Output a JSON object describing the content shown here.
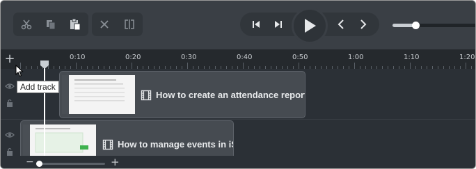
{
  "toolbar": {
    "edit_buttons": [
      {
        "name": "cut",
        "icon": "scissors-icon"
      },
      {
        "name": "copy",
        "icon": "copy-icon"
      },
      {
        "name": "paste",
        "icon": "paste-icon"
      }
    ],
    "cut_buttons": [
      {
        "name": "delete",
        "icon": "x-icon"
      },
      {
        "name": "split",
        "icon": "split-icon"
      }
    ],
    "playback": [
      "step-back-icon",
      "step-forward-icon",
      "play-icon",
      "prev-icon",
      "next-icon"
    ],
    "scrub_position": 0.27
  },
  "ruler": {
    "add_track_label": "+",
    "ticks": [
      "0:10",
      "0:20",
      "0:30",
      "0:40",
      "0:50",
      "1:00",
      "1:10",
      "1:20"
    ]
  },
  "tooltip": {
    "text": "Add track"
  },
  "clips": [
    {
      "title": "How to create an attendance report?"
    },
    {
      "title": "How to manage events in iSp"
    }
  ],
  "zoom": {
    "minus": "−",
    "plus": "+",
    "level": 0.0
  },
  "colors": {
    "toolbar": "#3a3f45",
    "ruler": "#25292d",
    "timeline": "#2b3036",
    "clip": "#464b51",
    "playhead": "#ffffff"
  }
}
